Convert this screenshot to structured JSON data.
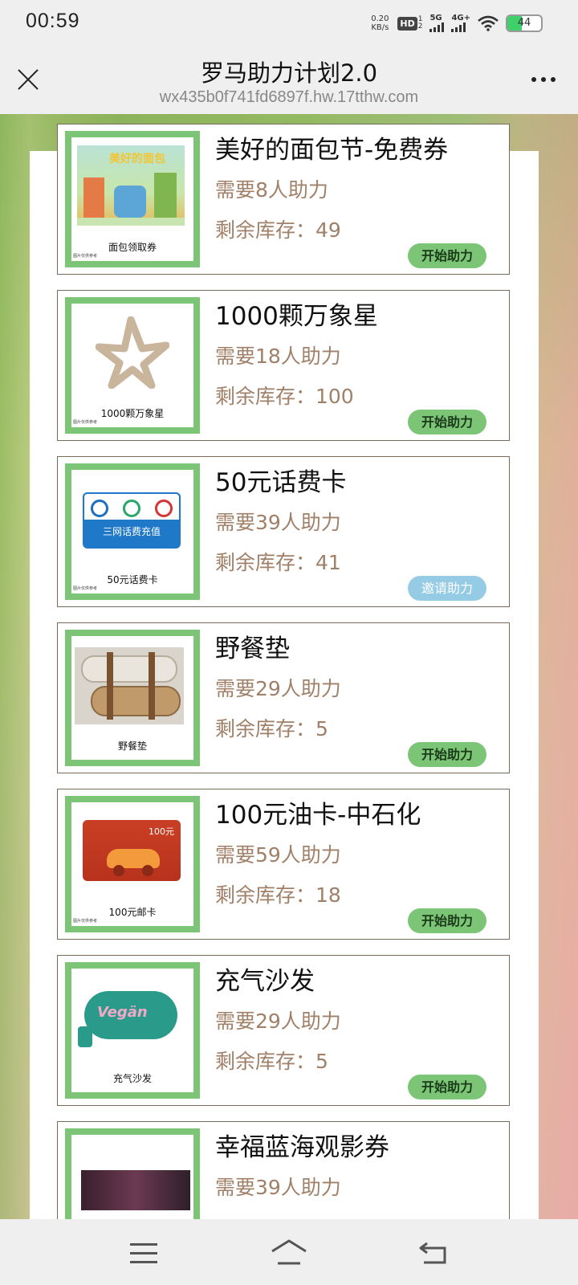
{
  "status_bar": {
    "time": "00:59",
    "net_speed_value": "0.20",
    "net_speed_unit": "KB/s",
    "hd_label": "HD",
    "hd_top": "1",
    "hd_bottom": "2",
    "signal1_label": "5G",
    "signal2_label": "4G+",
    "battery_level": "44",
    "battery_percent": 44,
    "battery_color": "#3fd06a"
  },
  "header": {
    "title": "罗马助力计划2.0",
    "url": "wx435b0f741fd6897f.hw.17tthw.com",
    "close_icon": "close-icon",
    "more_icon": "more-icon"
  },
  "colors": {
    "accent_green": "#7cc576",
    "invite_blue": "#96cbe6",
    "detail_brown": "#a08068"
  },
  "items": [
    {
      "title": "美好的面包节-免费券",
      "need": "需要8人助力",
      "stock": "剩余库存：49",
      "button": "开始助力",
      "img_caption": "面包领取券",
      "img_note": "图片仅供参考",
      "img_art_text": "美好的面包"
    },
    {
      "title": "1000颗万象星",
      "need": "需要18人助力",
      "stock": "剩余库存：100",
      "button": "开始助力",
      "img_caption": "1000颗万象星",
      "img_note": "图片仅供参考"
    },
    {
      "title": "50元话费卡",
      "need": "需要39人助力",
      "stock": "剩余库存：41",
      "button": "邀请助力",
      "img_caption": "50元话费卡",
      "img_note": "图片仅供参考",
      "img_art_text": "三网话费充值"
    },
    {
      "title": "野餐垫",
      "need": "需要29人助力",
      "stock": "剩余库存：5",
      "button": "开始助力",
      "img_caption": "野餐垫"
    },
    {
      "title": "100元油卡-中石化",
      "need": "需要59人助力",
      "stock": "剩余库存：18",
      "button": "开始助力",
      "img_caption": "100元邮卡",
      "img_note": "图片仅供参考",
      "img_art_text": "100元"
    },
    {
      "title": "充气沙发",
      "need": "需要29人助力",
      "stock": "剩余库存：5",
      "button": "开始助力",
      "img_caption": "充气沙发",
      "img_art_text": "Vegän"
    },
    {
      "title": "幸福蓝海观影券",
      "need": "需要39人助力"
    }
  ],
  "nav_bar": {
    "menu_icon": "menu-icon",
    "home_icon": "home-icon",
    "back_icon": "back-icon"
  }
}
